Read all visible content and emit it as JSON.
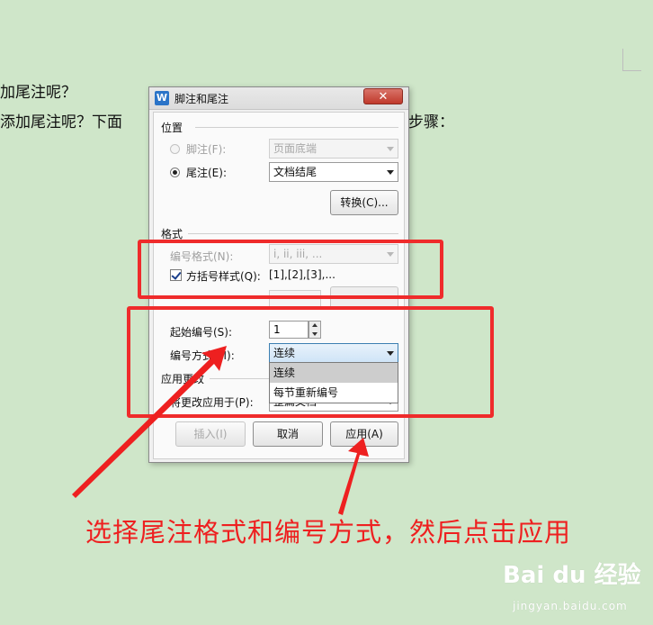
{
  "document": {
    "line1": "加尾注呢？",
    "line2a": "添加尾注呢？下面",
    "line2b": "步骤："
  },
  "dialog": {
    "title": "脚注和尾注",
    "icon_letter": "W",
    "close_label": "✕",
    "position_section": "位置",
    "footnote_label": "脚注(F):",
    "footnote_value": "页面底端",
    "endnote_label": "尾注(E):",
    "endnote_value": "文档结尾",
    "convert_button": "转换(C)...",
    "format_section": "格式",
    "number_format_label": "编号格式(N):",
    "number_format_value": "i, ii, iii, ...",
    "bracket_label": "方括号样式(Q):",
    "bracket_value": "[1],[2],[3],...",
    "bracket_checked": true,
    "start_number_label": "起始编号(S):",
    "start_number_value": "1",
    "numbering_label": "编号方式(M):",
    "numbering_value": "连续",
    "numbering_options": [
      "连续",
      "每节重新编号"
    ],
    "apply_section": "应用更改",
    "apply_to_label": "将更改应用于(P):",
    "apply_to_value": "整篇文档",
    "insert_button": "插入(I)",
    "cancel_button": "取消",
    "apply_button": "应用(A)"
  },
  "annotation": {
    "caption": "选择尾注格式和编号方式，然后点击应用",
    "color": "#ee2020"
  },
  "watermark": {
    "logo": "Bai du 经验",
    "url": "jingyan.baidu.com"
  }
}
